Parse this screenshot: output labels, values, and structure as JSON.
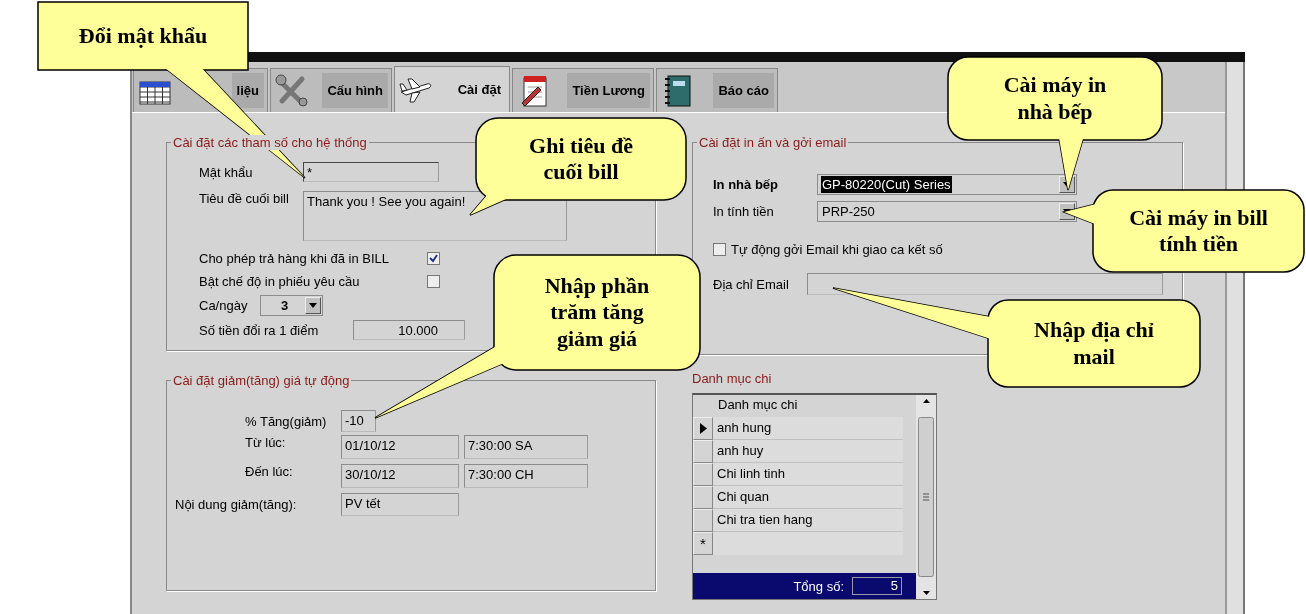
{
  "tabs": [
    {
      "label": "liệu",
      "selected": false,
      "kind": "table"
    },
    {
      "label": "Cấu hình",
      "selected": false,
      "kind": "tools"
    },
    {
      "label": "Cài đặt",
      "selected": true,
      "kind": "plane"
    },
    {
      "label": "Tiền Lương",
      "selected": false,
      "kind": "notepad"
    },
    {
      "label": "Báo cáo",
      "selected": false,
      "kind": "book"
    }
  ],
  "system_settings": {
    "title": "Cài đặt các tham số cho hệ thống",
    "password": {
      "label": "Mật khẩu",
      "value": "*"
    },
    "bill_footer": {
      "label": "Tiêu đề cuối bill",
      "value": "Thank you ! See you again!"
    },
    "options": [
      {
        "label": "Cho phép trả hàng khi đã in BILL",
        "checked": true
      },
      {
        "label": "Bật chế độ in phiếu yêu cầu",
        "checked": false
      }
    ],
    "shifts": {
      "label": "Ca/ngày",
      "value": "3"
    },
    "points": {
      "label": "Số tiền đổi ra 1 điểm",
      "value": "10.000"
    }
  },
  "discount_settings": {
    "title": "Cài đặt giảm(tăng) giá tự động",
    "percent": {
      "label": "% Tăng(giảm)",
      "value": "-10"
    },
    "from": {
      "label": "Từ lúc:",
      "date": "01/10/12",
      "time": "7:30:00 SA"
    },
    "to": {
      "label": "Đến lúc:",
      "date": "30/10/12",
      "time": "7:30:00 CH"
    },
    "description": {
      "label": "Nội dung giảm(tăng):",
      "value": "PV tết"
    }
  },
  "print_email": {
    "title": "Cài đặt in ấn và gởi email",
    "printers": [
      {
        "label": "In nhà bếp",
        "value": "GP-80220(Cut) Series",
        "selected": true
      },
      {
        "label": "In tính tiền",
        "value": "PRP-250",
        "selected": false
      }
    ],
    "auto_email": {
      "label": "Tự động gởi Email khi giao ca kết số",
      "checked": false
    },
    "email": {
      "label": "Địa chỉ Email"
    }
  },
  "expense_categories": {
    "title": "Danh mục chi",
    "column": "Danh mục chi",
    "rows": [
      {
        "name": "anh hung",
        "selected": true
      },
      {
        "name": "anh huy",
        "selected": false
      },
      {
        "name": "Chi linh tinh",
        "selected": false
      },
      {
        "name": "Chi quan",
        "selected": false
      },
      {
        "name": "Chi tra tien hang",
        "selected": false
      }
    ],
    "new_row_marker": "*",
    "total_label": "Tổng số:",
    "total": "5"
  },
  "callouts": [
    {
      "text": "Đổi mật khẩu"
    },
    {
      "text": "Ghi tiêu đề\ncuối bill"
    },
    {
      "text": "Nhập phần\ntrăm tăng\ngiảm giá"
    },
    {
      "text": "Cài máy in\nnhà bếp"
    },
    {
      "text": "Cài máy in bill\ntính tiền"
    },
    {
      "text": "Nhập địa chỉ\nmail"
    }
  ]
}
